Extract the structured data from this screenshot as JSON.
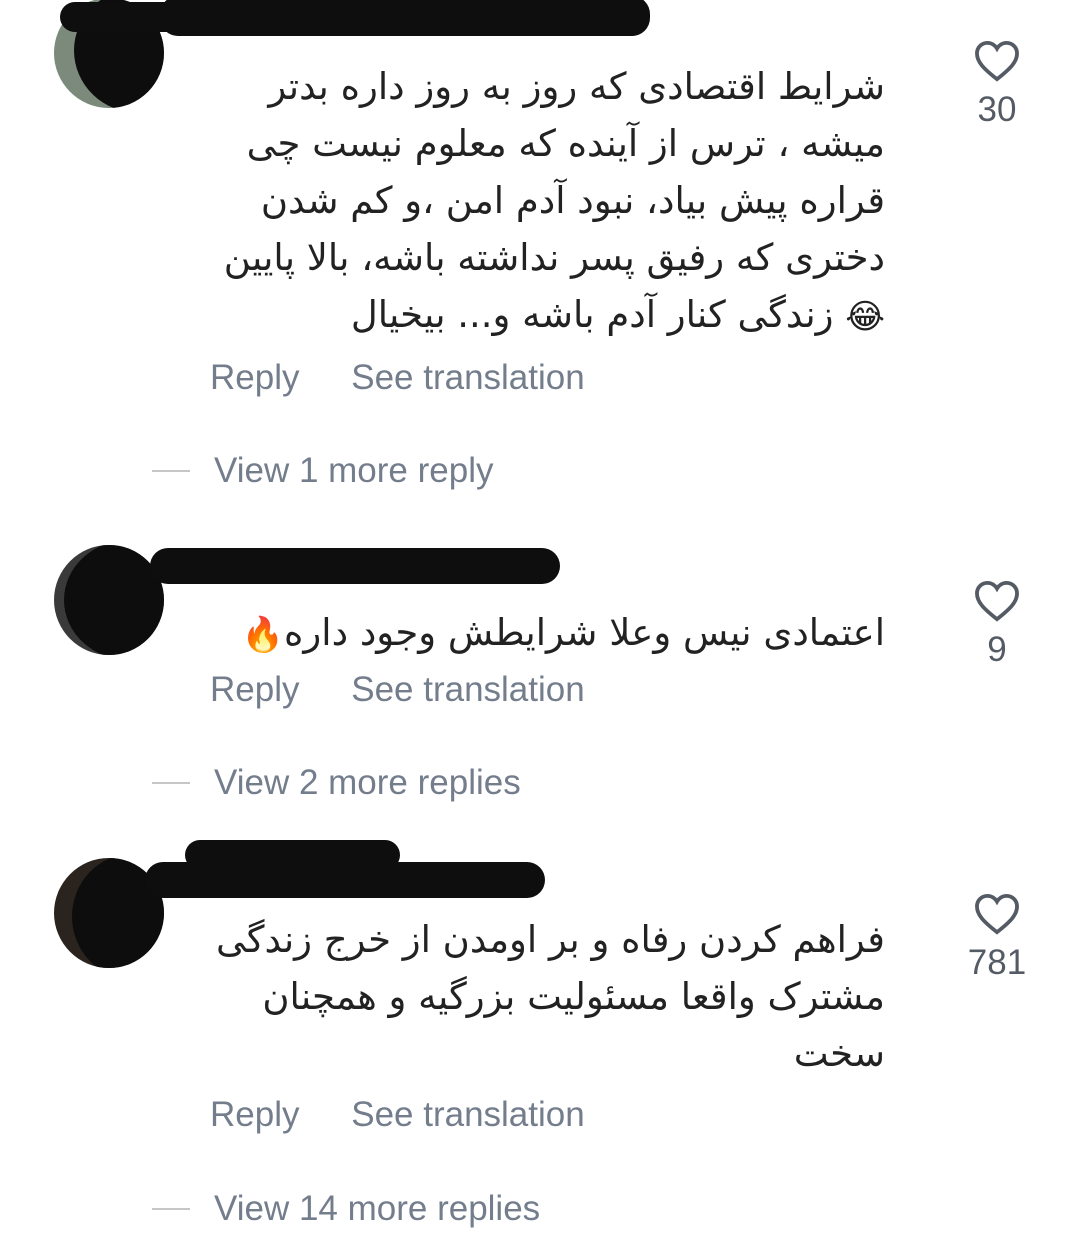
{
  "comments": [
    {
      "text_lines": [
        "شرایط اقتصادی که روز به روز داره بدتر",
        "میشه ، ترس از آینده که معلوم نیست چی",
        "قراره پیش بیاد، نبود آدم امن ،و کم شدن",
        "دختری که رفیق پسر نداشته باشه، بالا پایین",
        "زندگی کنار آدم باشه و... بیخیال"
      ],
      "emoji": "😂",
      "reply_label": "Reply",
      "translate_label": "See translation",
      "like_count": "30",
      "view_replies": "View 1 more reply"
    },
    {
      "text_lines": [
        "اعتمادی نیس وعلا شرایطش وجود داره"
      ],
      "emoji": "🔥",
      "reply_label": "Reply",
      "translate_label": "See translation",
      "like_count": "9",
      "view_replies": "View 2 more replies"
    },
    {
      "text_lines": [
        "فراهم کردن رفاه و بر اومدن از خرج زندگی",
        "مشترک واقعا مسئولیت بزرگیه و همچنان",
        "سخت"
      ],
      "emoji": "",
      "reply_label": "Reply",
      "translate_label": "See translation",
      "like_count": "781",
      "view_replies": "View 14 more replies"
    }
  ],
  "icons": {
    "like": "heart-outline-icon"
  },
  "colors": {
    "text": "#222222",
    "secondary": "#737d8c",
    "like_icon": "#555b64",
    "redaction": "#0e0e0e"
  }
}
